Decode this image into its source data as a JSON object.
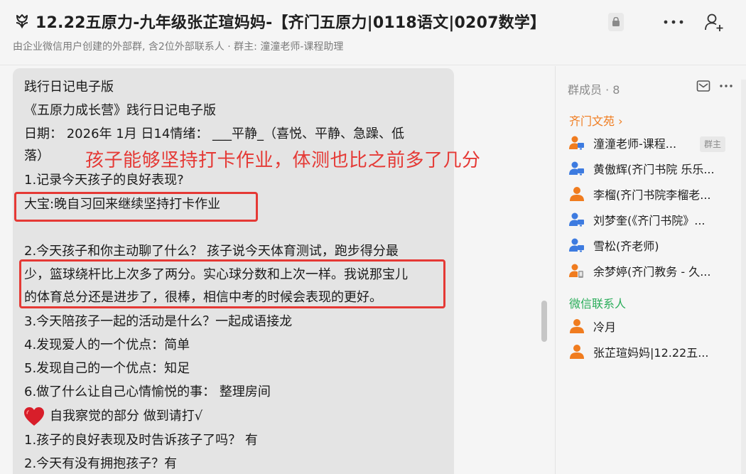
{
  "header": {
    "title": "12.22五原力-九年级张芷瑄妈妈-【齐门五原力|0118语文|0207数学】",
    "subtitle": "由企业微信用户创建的外部群, 含2位外部联系人 · 群主: 潼潼老师-课程助理",
    "icons": {
      "group": "tulip-icon",
      "lock": "lock-icon",
      "more": "more-icon",
      "add": "add-member-icon"
    }
  },
  "message": {
    "lines": [
      "践行日记电子版",
      "《五原力成长营》践行日记电子版",
      "日期：  2026年 1月 日14情绪：  ___平静_（喜悦、平静、急躁、低",
      "落）",
      " 1.记录今天孩子的良好表现?",
      "大宝:晚自习回来继续坚持打卡作业",
      " 2.今天孩子和你主动聊了什么？ 孩子说今天体育测试，跑步得分最",
      "少，篮球绕杆比上次多了两分。实心球分数和上次一样。我说那宝儿",
      "的体育总分还是进步了，很棒，相信中考的时候会表现的更好。",
      " 3.今天陪孩子一起的活动是什么？一起成语接龙",
      "  4.发现爱人的一个优点：简单",
      " 5.发现自己的一个优点：知足",
      "  6.做了什么让自己心情愉悦的事：  整理房间",
      "自我察觉的部分 做到请打√",
      " 1.孩子的良好表现及时告诉孩子了吗？  有",
      " 2.今天有没有拥抱孩子？有"
    ],
    "annotation": "孩子能够坚持打卡作业，体测也比之前多了几分",
    "annotation_color": "#e53935",
    "heart_icon": "red-heart-icon"
  },
  "members": {
    "header": "群成员 · 8",
    "section_company": "齐门文苑 ›",
    "section_wechat": "微信联系人",
    "owner_tag": "群主",
    "company_members": [
      {
        "name": "潼潼老师-课程...",
        "icon": "person-screen-icon"
      },
      {
        "name": "黄傲辉(齐门书院 乐乐...",
        "icon": "person-screen-icon"
      },
      {
        "name": "李榴(齐门书院李榴老...",
        "icon": "person-icon"
      },
      {
        "name": "刘梦奎(《齐门书院》...",
        "icon": "person-screen-icon"
      },
      {
        "name": "雪松(齐老师)",
        "icon": "person-screen-icon"
      },
      {
        "name": "余梦婷(齐门教务 - 久...",
        "icon": "person-phone-icon"
      }
    ],
    "wechat_members": [
      {
        "name": "冷月",
        "icon": "person-icon"
      },
      {
        "name": "张芷瑄妈妈|12.22五...",
        "icon": "person-icon"
      }
    ],
    "colors": {
      "orange": "#f07c1f",
      "green": "#2aad5a",
      "blue": "#3d7be0"
    }
  }
}
